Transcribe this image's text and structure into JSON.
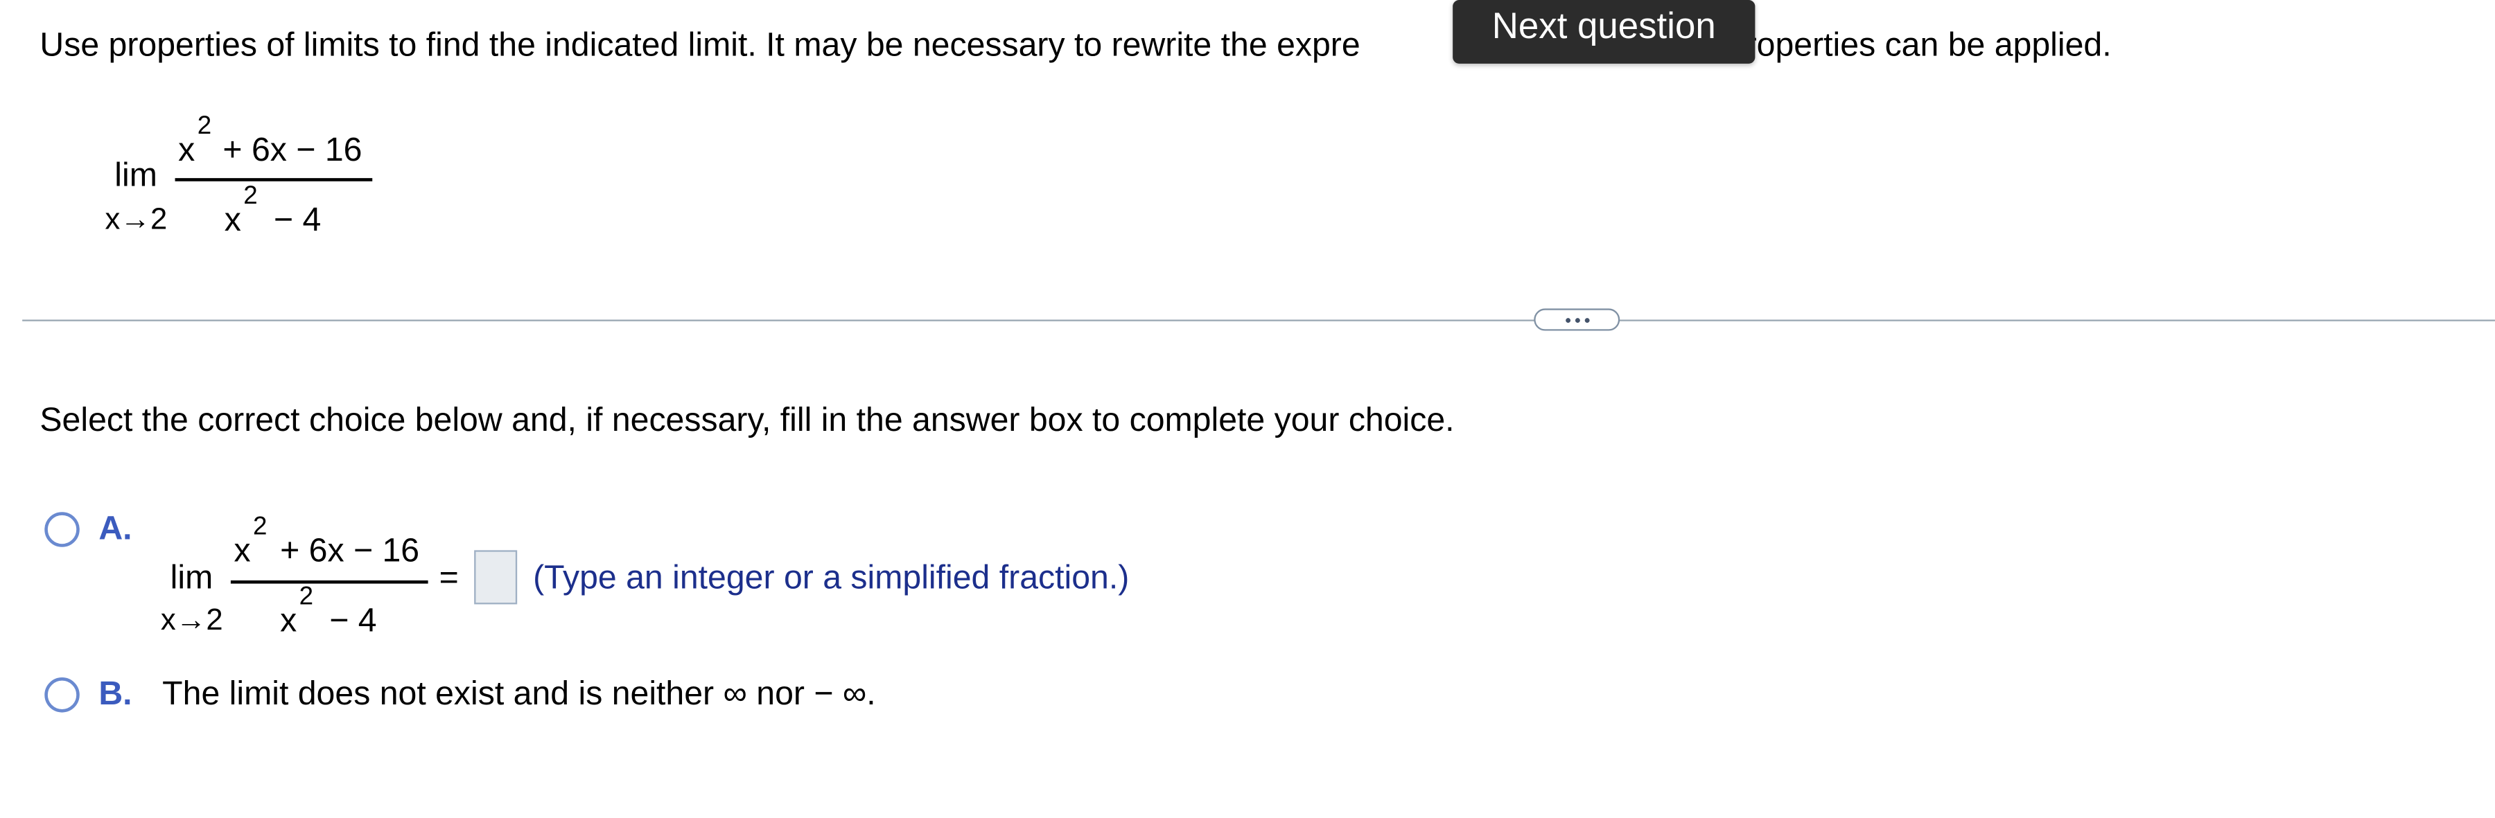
{
  "question": {
    "prompt_before": "Use properties of limits to find the indicated limit. It may be necessary to rewrite the expre",
    "prompt_after": "roperties can be applied.",
    "limit": {
      "lim": "lim",
      "approach": "x→2",
      "numerator_base": "x",
      "numerator_exp": "2",
      "numerator_rest": "+ 6x − 16",
      "denominator_base": "x",
      "denominator_exp": "2",
      "denominator_rest": "− 4"
    }
  },
  "tooltip": {
    "label": "Next question"
  },
  "instructions": "Select the correct choice below and, if necessary,  fill in the answer box to complete your choice.",
  "choices": {
    "a": {
      "letter": "A.",
      "equals": "=",
      "hint": "(Type an integer or a simplified fraction.)",
      "answer_value": ""
    },
    "b": {
      "letter": "B.",
      "text": "The limit does not exist and is neither ∞ nor  − ∞."
    }
  },
  "colors": {
    "accent": "#3b5bbe",
    "hint": "#1c2f8c",
    "tooltip_bg": "#2c2c2c"
  }
}
